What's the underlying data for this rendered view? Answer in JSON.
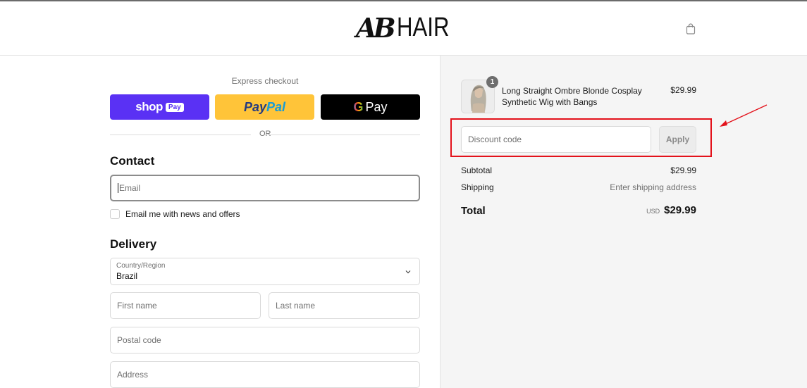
{
  "header": {
    "logo_ab": "AB",
    "logo_hair": "HAIR",
    "cart_icon": "shopping-bag-icon"
  },
  "express": {
    "label": "Express checkout",
    "shop_pay": {
      "text": "shop",
      "badge": "Pay",
      "color": "#5a31f4"
    },
    "paypal": {
      "pay": "Pay",
      "pal": "Pal",
      "color": "#ffc439"
    },
    "google_pay": {
      "g": "G",
      "text": "Pay",
      "color": "#000000"
    },
    "or": "OR"
  },
  "contact": {
    "title": "Contact",
    "email_placeholder": "Email",
    "newsletter_label": "Email me with news and offers"
  },
  "delivery": {
    "title": "Delivery",
    "country_label": "Country/Region",
    "country_value": "Brazil",
    "first_name_placeholder": "First name",
    "last_name_placeholder": "Last name",
    "postal_code_placeholder": "Postal code",
    "address_placeholder": "Address"
  },
  "cart": {
    "item": {
      "quantity": "1",
      "name": "Long Straight Ombre Blonde Cosplay Synthetic Wig with Bangs",
      "price": "$29.99"
    },
    "discount": {
      "placeholder": "Discount code",
      "apply_label": "Apply"
    },
    "summary": {
      "subtotal_label": "Subtotal",
      "subtotal_value": "$29.99",
      "shipping_label": "Shipping",
      "shipping_value": "Enter shipping address",
      "total_label": "Total",
      "currency": "USD",
      "total_value": "$29.99"
    }
  },
  "colors": {
    "highlight": "#e3121b",
    "panel_bg": "#f5f5f5"
  }
}
